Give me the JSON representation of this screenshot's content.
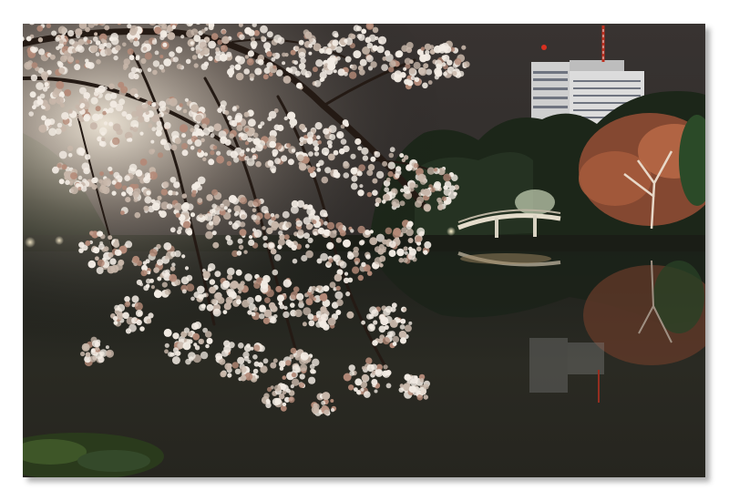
{
  "photo": {
    "subject": "night-cherry-blossoms-pond",
    "colors": {
      "sky": "#332f2d",
      "water": "#282822",
      "blossom": "#f3ece4",
      "blossom_shadow": "#c8b7aa",
      "branch": "#241a14",
      "tree_dark": "#1e2a1a",
      "tree_autumn": "#a45a3c",
      "building": "#d9d9d9",
      "bridge": "#d8d2c2",
      "beacon": "#d83020"
    }
  }
}
